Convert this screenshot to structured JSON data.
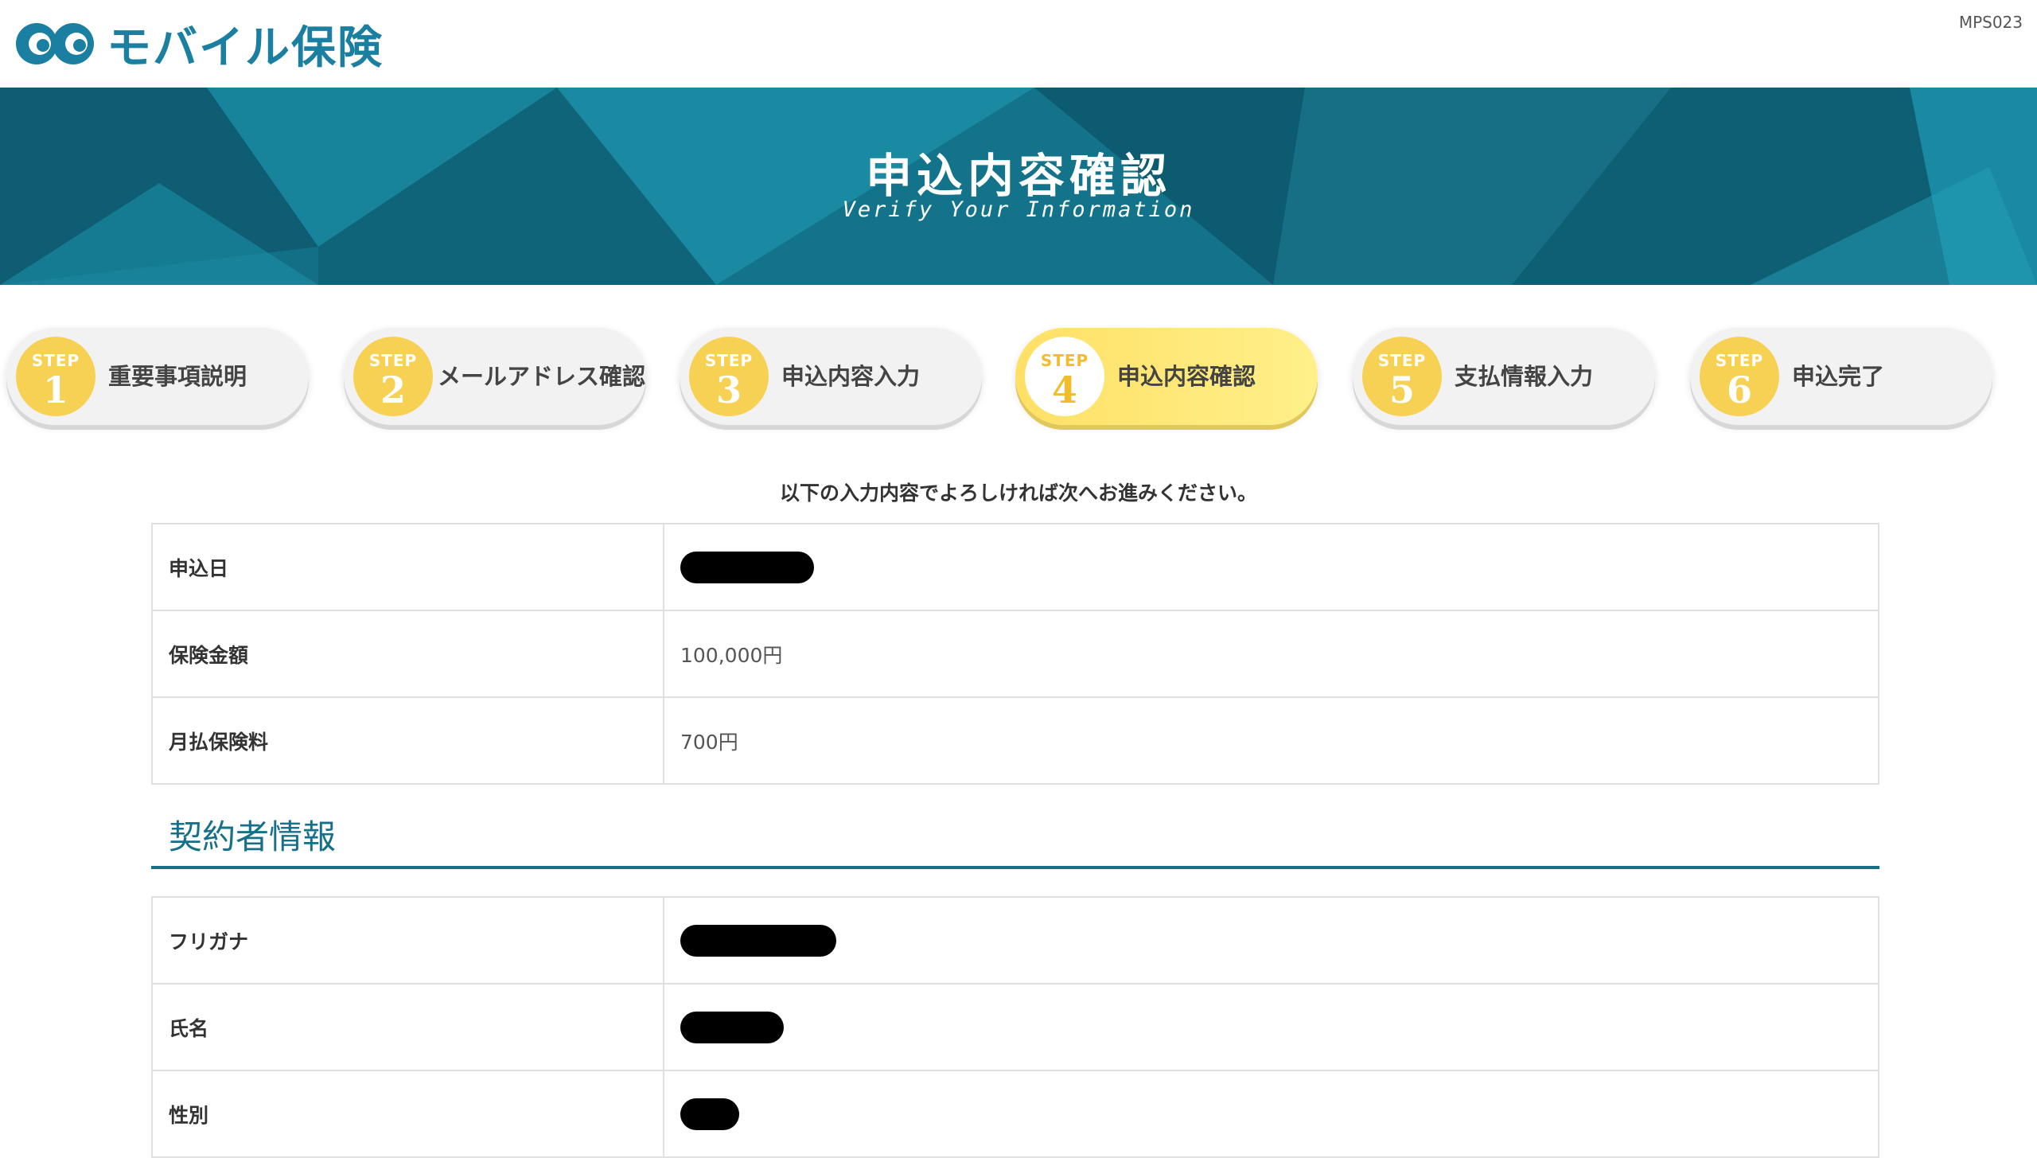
{
  "header": {
    "logo_text": "モバイル保険",
    "page_code": "MPS023"
  },
  "banner": {
    "title": "申込内容確認",
    "subtitle": "Verify Your Information"
  },
  "steps": [
    {
      "word": "STEP",
      "number": "1",
      "label": "重要事項説明",
      "active": false
    },
    {
      "word": "STEP",
      "number": "2",
      "label": "メールアドレス確認",
      "active": false
    },
    {
      "word": "STEP",
      "number": "3",
      "label": "申込内容入力",
      "active": false
    },
    {
      "word": "STEP",
      "number": "4",
      "label": "申込内容確認",
      "active": true
    },
    {
      "word": "STEP",
      "number": "5",
      "label": "支払情報入力",
      "active": false
    },
    {
      "word": "STEP",
      "number": "6",
      "label": "申込完了",
      "active": false
    }
  ],
  "lead_text": "以下の入力内容でよろしければ次へお進みください。",
  "summary_rows": [
    {
      "label": "申込日",
      "value": "",
      "redacted": true
    },
    {
      "label": "保険金額",
      "value": "100,000円",
      "redacted": false
    },
    {
      "label": "月払保険料",
      "value": "700円",
      "redacted": false
    }
  ],
  "contract_section": {
    "title": "契約者情報",
    "rows": [
      {
        "label": "フリガナ",
        "value": "",
        "redacted": true
      },
      {
        "label": "氏名",
        "value": "",
        "redacted": true
      },
      {
        "label": "性別",
        "value": "",
        "redacted": true
      }
    ]
  },
  "colors": {
    "brand": "#1a7fa0",
    "section_accent": "#16708a",
    "step_yellow": "#f7d154"
  }
}
